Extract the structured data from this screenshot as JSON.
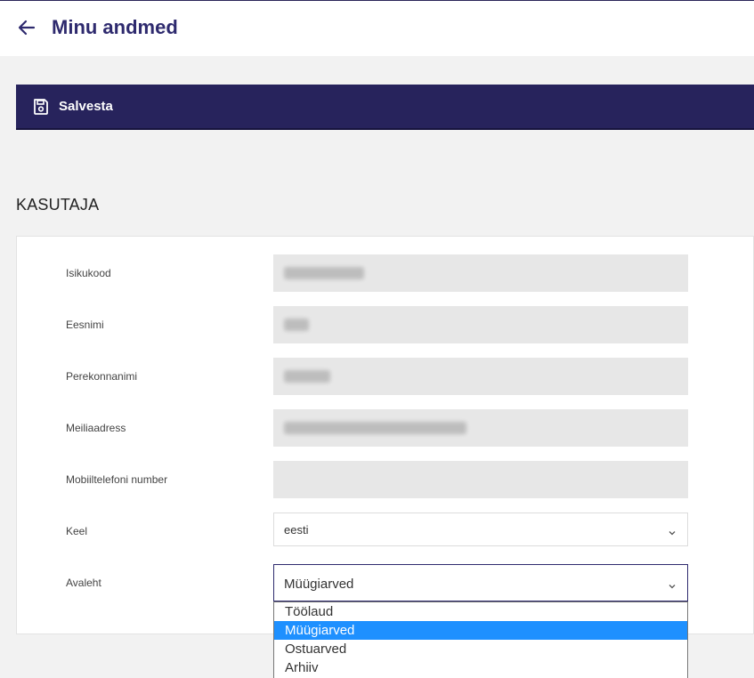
{
  "header": {
    "title": "Minu andmed",
    "back_icon": "arrow-left-icon"
  },
  "toolbar": {
    "save_label": "Salvesta",
    "save_icon": "floppy-disk-icon"
  },
  "section": {
    "title": "KASUTAJA"
  },
  "form": {
    "isikukood": {
      "label": "Isikukood"
    },
    "eesnimi": {
      "label": "Eesnimi"
    },
    "perekonnanimi": {
      "label": "Perekonnanimi"
    },
    "meiliaadress": {
      "label": "Meiliaadress"
    },
    "mobiil": {
      "label": "Mobiiltelefoni number",
      "value": ""
    },
    "keel": {
      "label": "Keel",
      "value": "eesti"
    },
    "avaleht": {
      "label": "Avaleht",
      "value": "Müügiarved",
      "options": [
        "Töölaud",
        "Müügiarved",
        "Ostuarved",
        "Arhiiv"
      ]
    }
  },
  "colors": {
    "accent": "#27235c",
    "title": "#2e2a6e",
    "selected_option": "#1e90ff"
  }
}
